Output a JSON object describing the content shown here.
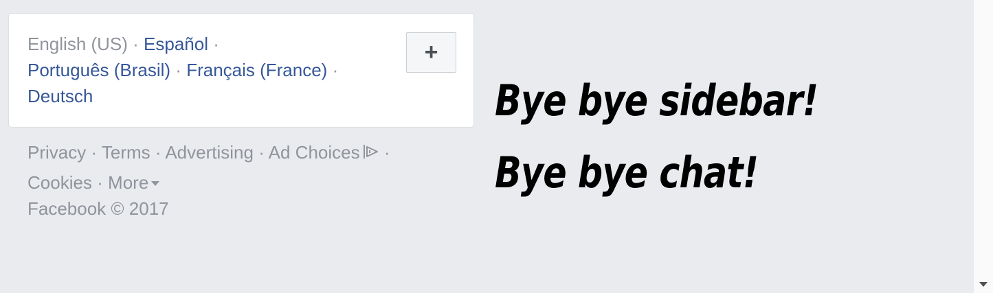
{
  "languages": {
    "current": "English (US)",
    "separator": " · ",
    "options": [
      "Español",
      "Português (Brasil)",
      "Français (France)",
      "Deutsch"
    ],
    "add_button_label": "+"
  },
  "footer": {
    "privacy": "Privacy",
    "terms": "Terms",
    "advertising": "Advertising",
    "ad_choices": "Ad Choices",
    "cookies": "Cookies",
    "more": "More",
    "copyright": "Facebook © 2017"
  },
  "headline": {
    "line1": "Bye bye sidebar!",
    "line2": "Bye bye chat!"
  },
  "colors": {
    "background": "#e9ebee",
    "link_blue": "#365899",
    "muted_gray": "#90949c"
  }
}
